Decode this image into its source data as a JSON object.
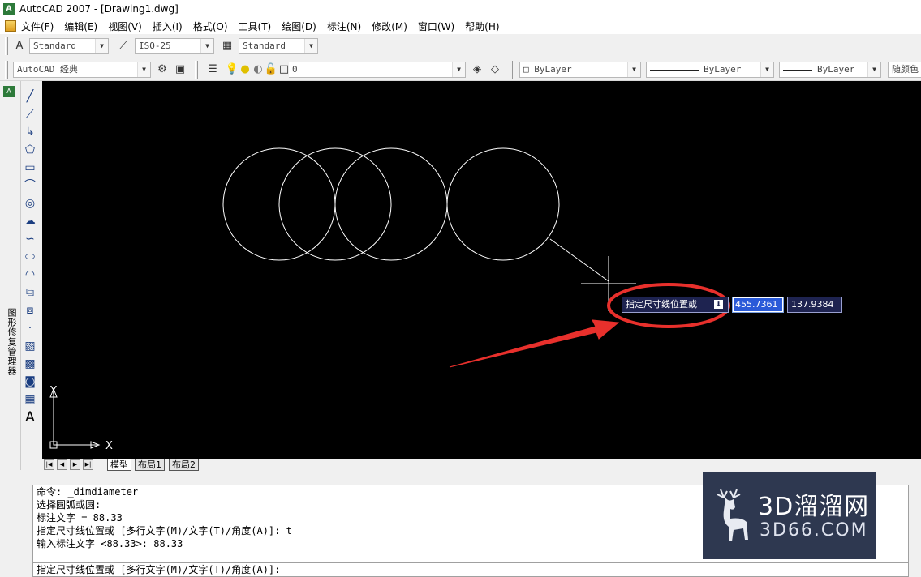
{
  "window": {
    "title": "AutoCAD 2007 - [Drawing1.dwg]",
    "app_icon": "autocad-logo"
  },
  "menu": {
    "items": [
      "文件(F)",
      "编辑(E)",
      "视图(V)",
      "插入(I)",
      "格式(O)",
      "工具(T)",
      "绘图(D)",
      "标注(N)",
      "修改(M)",
      "窗口(W)",
      "帮助(H)"
    ]
  },
  "toolbar_styles": {
    "text_style": "Standard",
    "dim_style": "ISO-25",
    "table_style": "Standard"
  },
  "toolbar_layers": {
    "workspace": "AutoCAD 经典",
    "layer": "0",
    "color": "ByLayer",
    "linetype": "ByLayer",
    "lineweight": "ByLayer",
    "plotstyle": "随颜色"
  },
  "left_panel": {
    "label": "图形修复管理器"
  },
  "draw_tools": [
    "line-icon",
    "construction-line-icon",
    "polyline-icon",
    "polygon-icon",
    "rectangle-icon",
    "arc-icon",
    "circle-icon",
    "revision-cloud-icon",
    "spline-icon",
    "ellipse-icon",
    "ellipse-arc-icon",
    "insert-block-icon",
    "make-block-icon",
    "point-icon",
    "hatch-icon",
    "gradient-icon",
    "region-icon",
    "table-icon",
    "mtext-icon"
  ],
  "canvas": {
    "background": "#000000",
    "ucs": {
      "x_label": "X",
      "y_label": "Y"
    }
  },
  "dynamic_input": {
    "prompt": "指定尺寸线位置或",
    "dropdown_icon": "down-arrow-icon",
    "value1": "455.7361",
    "value2": "137.9384"
  },
  "annotation": {
    "color": "#e8302c"
  },
  "tabs": [
    "模型",
    "布局1",
    "布局2"
  ],
  "command": {
    "history": [
      "命令: _dimdiameter",
      "选择圆弧或圆:",
      "标注文字 = 88.33",
      "指定尺寸线位置或 [多行文字(M)/文字(T)/角度(A)]: t",
      "输入标注文字 <88.33>: 88.33"
    ],
    "current": "指定尺寸线位置或 [多行文字(M)/文字(T)/角度(A)]:"
  },
  "watermark": {
    "brand": "3D溜溜网",
    "domain": "3D66.COM",
    "logo": "deer-logo"
  }
}
